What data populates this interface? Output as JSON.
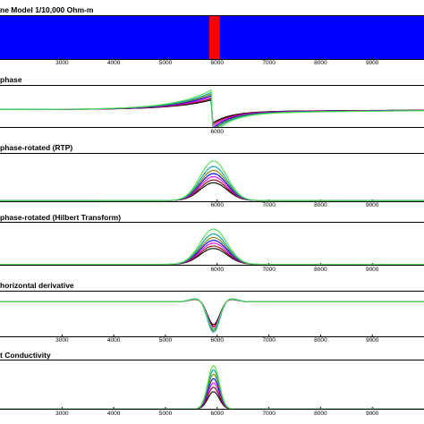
{
  "chart_data": [
    {
      "type": "heatmap",
      "title": "ne Model 1/10,000 Ohm-m",
      "xlim": [
        1800,
        10000
      ],
      "xticks": [
        3000,
        4000,
        5000,
        6000,
        7000,
        8000,
        9000
      ],
      "xtick_labels": [
        "3000",
        "4000",
        "5000",
        "6000",
        "7000",
        "8000",
        "9000"
      ],
      "background_color": "#0000ff",
      "body": {
        "x_start": 5850,
        "x_end": 6050,
        "color": "#ff0000"
      }
    },
    {
      "type": "line",
      "title": "phase",
      "xlim": [
        1800,
        10000
      ],
      "xticks": [
        6000
      ],
      "xtick_labels": [
        "6000"
      ],
      "shape": "antisymmetric",
      "center": 5900,
      "series_colors": [
        "#000000",
        "#8b0000",
        "#ff00ff",
        "#0000ff",
        "#808000",
        "#00a0a0",
        "#50e050"
      ]
    },
    {
      "type": "line",
      "title": "phase-rotated (RTP)",
      "xlim": [
        1800,
        10000
      ],
      "xticks": [
        6000,
        7000,
        8000,
        9000
      ],
      "xtick_labels": [
        "6000",
        "7000",
        "8000",
        "9000"
      ],
      "shape": "peak",
      "center": 5930,
      "series_colors": [
        "#000000",
        "#8b0000",
        "#ff00ff",
        "#0000ff",
        "#808000",
        "#00a0a0",
        "#50e050"
      ]
    },
    {
      "type": "line",
      "title": "phase-rotated (Hilbert Transform)",
      "xlim": [
        1800,
        10000
      ],
      "xticks": [
        6000,
        7000,
        8000,
        9000
      ],
      "xtick_labels": [
        "6000",
        "7000",
        "8000",
        "9000"
      ],
      "shape": "peak",
      "center": 5930,
      "series_colors": [
        "#000000",
        "#8b0000",
        "#ff00ff",
        "#0000ff",
        "#808000",
        "#00a0a0",
        "#50e050"
      ]
    },
    {
      "type": "line",
      "title": "horizontal derivative",
      "xlim": [
        1800,
        10000
      ],
      "xticks": [
        3000,
        4000,
        5000,
        6000,
        7000,
        8000,
        9000
      ],
      "xtick_labels": [
        "3000",
        "4000",
        "5000",
        "6000",
        "7000",
        "8000",
        "9000"
      ],
      "shape": "trough",
      "center": 5930,
      "series_colors": [
        "#000000",
        "#8b0000",
        "#ff00ff",
        "#0000ff",
        "#808000",
        "#00a0a0",
        "#50e050"
      ]
    },
    {
      "type": "line",
      "title": "t Conductivity",
      "xlim": [
        1800,
        10000
      ],
      "xticks": [
        3000,
        4000,
        5000,
        6000,
        7000,
        8000,
        9000
      ],
      "xtick_labels": [
        "3000",
        "4000",
        "5000",
        "6000",
        "7000",
        "8000",
        "9000"
      ],
      "shape": "narrow-peak",
      "center": 5930,
      "series_colors": [
        "#000000",
        "#8b0000",
        "#ff00ff",
        "#0000ff",
        "#808000",
        "#00a0a0",
        "#50e050"
      ]
    }
  ]
}
